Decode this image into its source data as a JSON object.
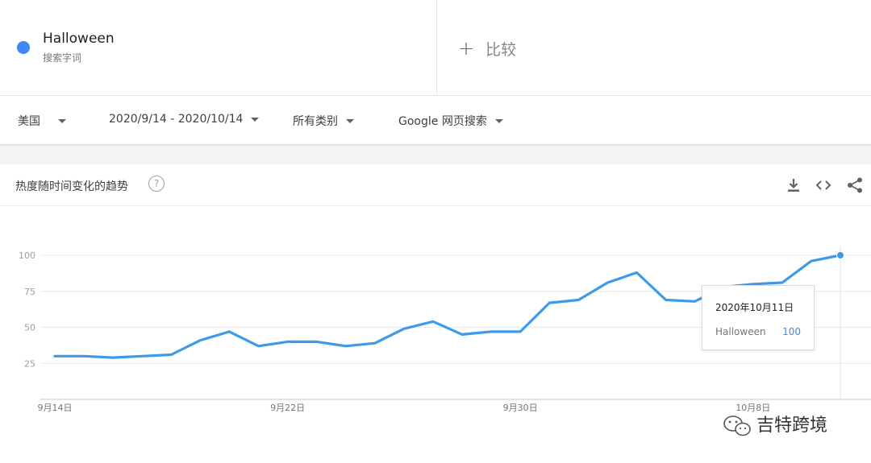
{
  "term": {
    "name": "Halloween",
    "type": "搜索字词",
    "color": "#4285f4"
  },
  "compare": {
    "icon": "plus-icon",
    "label": "比较"
  },
  "filters": {
    "geo": "美国",
    "time": "2020/9/14 - 2020/10/14",
    "category": "所有类别",
    "property": "Google 网页搜索"
  },
  "card": {
    "title": "热度随时间变化的趋势",
    "help": "?",
    "icons": [
      "download-icon",
      "embed-icon",
      "share-icon"
    ]
  },
  "chart_data": {
    "type": "line",
    "title": "",
    "xlabel": "",
    "ylabel": "",
    "x_ticks": [
      "9月14日",
      "9月22日",
      "9月30日",
      "10月8日"
    ],
    "x_tick_index": [
      0,
      8,
      16,
      24
    ],
    "y_ticks": [
      "25",
      "50",
      "75",
      "100"
    ],
    "ylim": [
      0,
      100
    ],
    "grid": true,
    "series": [
      {
        "name": "Halloween",
        "color": "#3d9ae8",
        "x": [
          "2020-09-14",
          "2020-09-15",
          "2020-09-16",
          "2020-09-17",
          "2020-09-18",
          "2020-09-19",
          "2020-09-20",
          "2020-09-21",
          "2020-09-22",
          "2020-09-23",
          "2020-09-24",
          "2020-09-25",
          "2020-09-26",
          "2020-09-27",
          "2020-09-28",
          "2020-09-29",
          "2020-09-30",
          "2020-10-01",
          "2020-10-02",
          "2020-10-03",
          "2020-10-04",
          "2020-10-05",
          "2020-10-06",
          "2020-10-07",
          "2020-10-08",
          "2020-10-09",
          "2020-10-10",
          "2020-10-11"
        ],
        "values": [
          30,
          30,
          29,
          30,
          31,
          41,
          47,
          37,
          40,
          40,
          37,
          39,
          49,
          54,
          45,
          47,
          47,
          67,
          69,
          81,
          88,
          69,
          68,
          78,
          80,
          81,
          96,
          100
        ]
      }
    ],
    "highlight": {
      "index": 27
    }
  },
  "tooltip": {
    "date": "2020年10月11日",
    "term": "Halloween",
    "value": "100"
  },
  "watermark": {
    "text": "吉特跨境",
    "icon": "wechat-icon"
  }
}
